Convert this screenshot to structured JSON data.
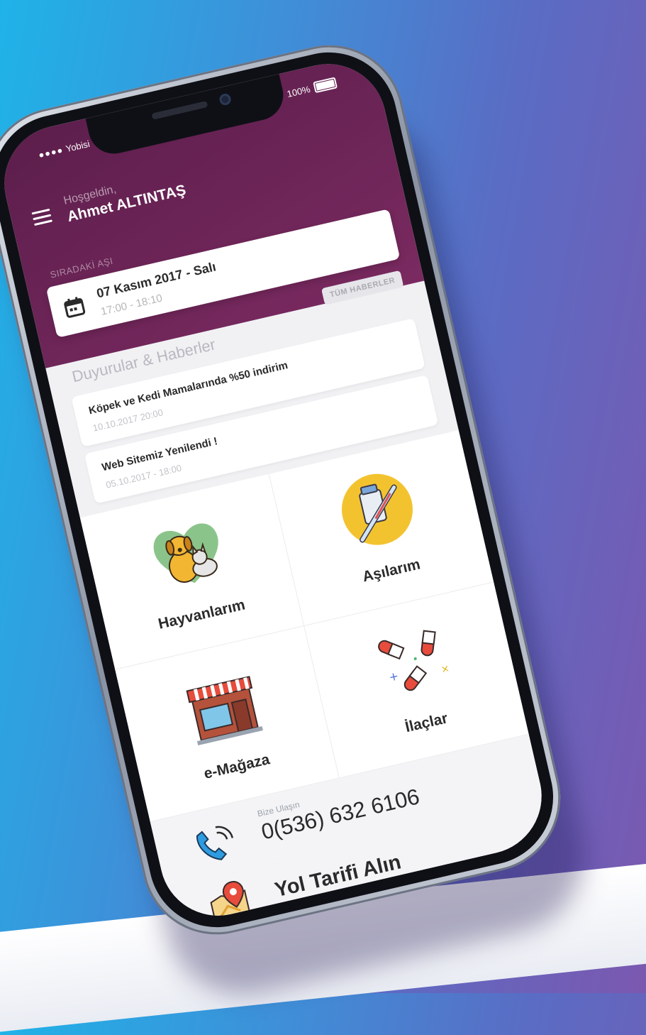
{
  "status_bar": {
    "carrier": "Yobisi",
    "battery": "100%"
  },
  "header": {
    "greeting": "Hoşgeldin,",
    "user_name": "Ahmet ALTINTAŞ",
    "next_vaccine_label": "SIRADAKİ AŞI"
  },
  "appointment": {
    "date": "07 Kasım 2017 - Salı",
    "time": "17:00 - 18:10"
  },
  "news": {
    "title": "Duyurular & Haberler",
    "all_button": "TÜM HABERLER",
    "items": [
      {
        "title": "Köpek ve Kedi Mamalarında %50 indirim",
        "date": "10.10.2017 20:00"
      },
      {
        "title": "Web Sitemiz Yenilendi !",
        "date": "05.10.2017 - 18:00"
      }
    ]
  },
  "menu": [
    {
      "label": "Hayvanlarım",
      "icon": "pets-icon"
    },
    {
      "label": "Aşılarım",
      "icon": "vaccine-icon"
    },
    {
      "label": "e-Mağaza",
      "icon": "store-icon"
    },
    {
      "label": "İlaçlar",
      "icon": "pills-icon"
    }
  ],
  "contact": {
    "label": "Bize Ulaşın",
    "phone": "0(536) 632 6106",
    "icon": "phone-icon"
  },
  "directions": {
    "label": "Yol Tarifi Alın",
    "icon": "map-pin-icon"
  },
  "colors": {
    "header": "#6b2456",
    "background": "#f1f1f4",
    "text": "#2a2a2a"
  }
}
